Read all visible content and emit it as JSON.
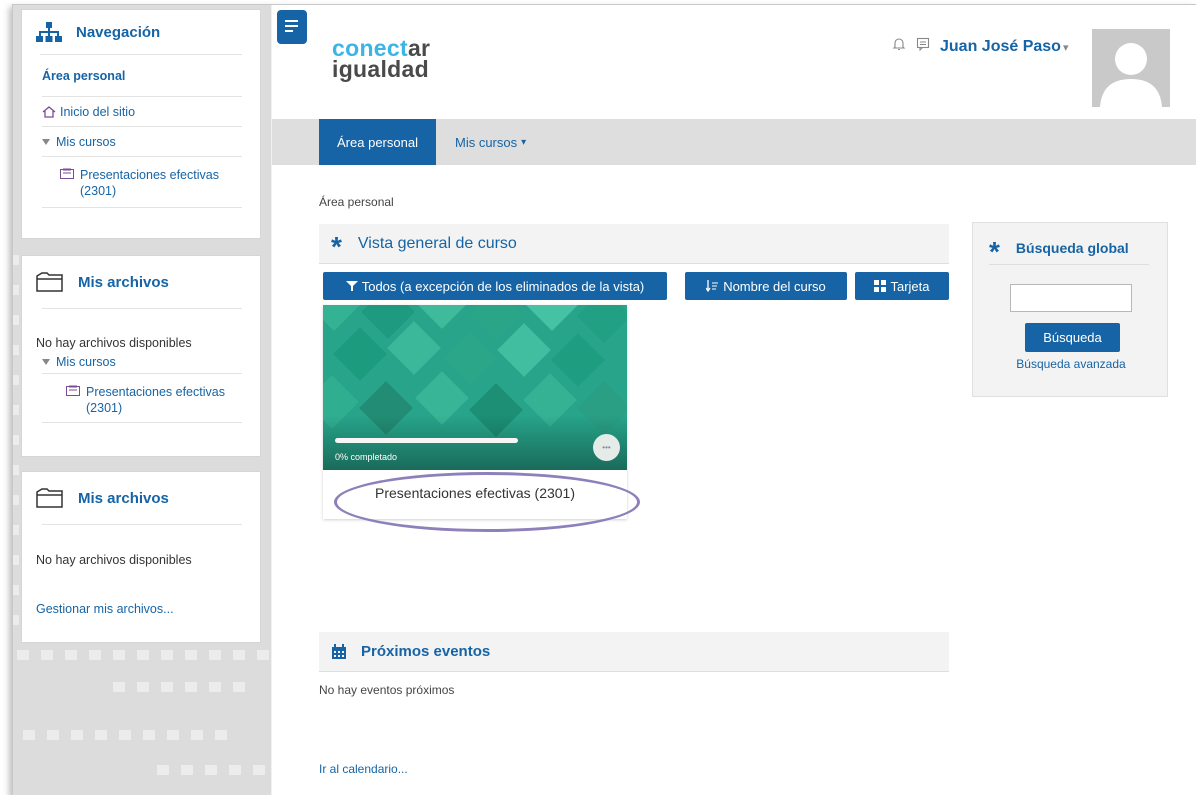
{
  "sidebar": {
    "nav_block": {
      "title": "Navegación",
      "area_personal": "Área personal",
      "inicio": "Inicio del sitio",
      "mis_cursos": "Mis cursos",
      "course": "Presentaciones efectivas (2301)"
    },
    "files_block_1": {
      "title": "Mis archivos",
      "empty": "No hay archivos disponibles",
      "mis_cursos": "Mis cursos",
      "course": "Presentaciones efectivas (2301)"
    },
    "files_block_2": {
      "title": "Mis archivos",
      "empty": "No hay archivos disponibles",
      "manage": "Gestionar mis archivos..."
    }
  },
  "header": {
    "logo_part1a": "conect",
    "logo_part1b": "ar",
    "logo_part2": "igualdad",
    "user_name": "Juan José Paso",
    "user_caret": "▾"
  },
  "navbar": {
    "active": "Área personal",
    "mis_cursos": "Mis cursos",
    "caret": "▾"
  },
  "breadcrumb": "Área personal",
  "overview": {
    "title": "Vista general de curso",
    "filter_button": "Todos (a excepción de los eliminados de la vista)",
    "sort_button": "Nombre del curso",
    "view_button": "Tarjeta",
    "course": {
      "title": "Presentaciones efectivas (2301)",
      "progress_percent": 0,
      "progress_text": "0% completado",
      "menu_glyph": "•••"
    }
  },
  "events": {
    "title": "Próximos eventos",
    "empty": "No hay eventos próximos",
    "calendar_link": "Ir al calendario..."
  },
  "search": {
    "title": "Búsqueda global",
    "input_value": "",
    "button": "Búsqueda",
    "advanced": "Búsqueda avanzada"
  },
  "colors": {
    "brand_blue": "#1664a5",
    "course_green": "#27a48a",
    "highlight_oval": "#8e80bb"
  }
}
